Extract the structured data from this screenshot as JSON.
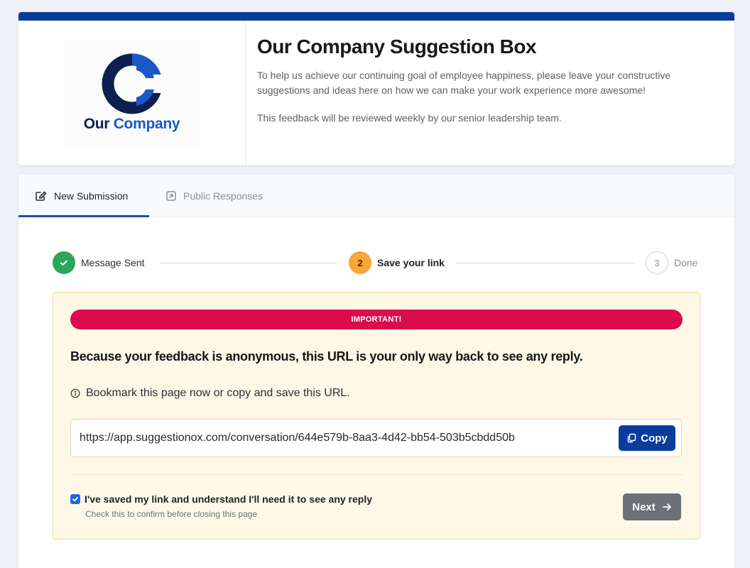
{
  "brand": {
    "logo_word_1": "Our",
    "logo_word_2": "Company",
    "logo_icon": "company-logo-icon",
    "accent": "#0a3d9a"
  },
  "header": {
    "title": "Our Company Suggestion Box",
    "description": "To help us achieve our continuing goal of employee happiness, please leave your constructive suggestions and ideas here on how we can make your work experience more awesome!",
    "review_note": "This feedback will be reviewed weekly by our senior leadership team."
  },
  "tabs": [
    {
      "label": "New Submission",
      "icon": "edit-icon",
      "active": true
    },
    {
      "label": "Public Responses",
      "icon": "external-link-icon",
      "active": false
    }
  ],
  "stepper": {
    "steps": [
      {
        "number": "1",
        "label": "Message Sent",
        "status": "complete"
      },
      {
        "number": "2",
        "label": "Save your link",
        "status": "current"
      },
      {
        "number": "3",
        "label": "Done",
        "status": "pending"
      }
    ]
  },
  "notice": {
    "badge": "IMPORTANT!",
    "headline": "Because your feedback is anonymous, this URL is your only way back to see any reply.",
    "hint": "Bookmark this page now or copy and save this URL.",
    "url": "https://app.suggestionox.com/conversation/644e579b-8aa3-4d42-bb54-503b5cbdd50b",
    "copy_label": "Copy"
  },
  "confirm": {
    "label": "I've saved my link and understand I'll need it to see any reply",
    "sublabel": "Check this to confirm before closing this page",
    "checked": true
  },
  "next_label": "Next",
  "colors": {
    "important": "#dc0c4c",
    "step_complete": "#2aa55a",
    "step_current": "#f8a638",
    "primary_button": "#0b3d9c",
    "next_button": "#6b7178",
    "notice_bg": "#fff8e6"
  }
}
